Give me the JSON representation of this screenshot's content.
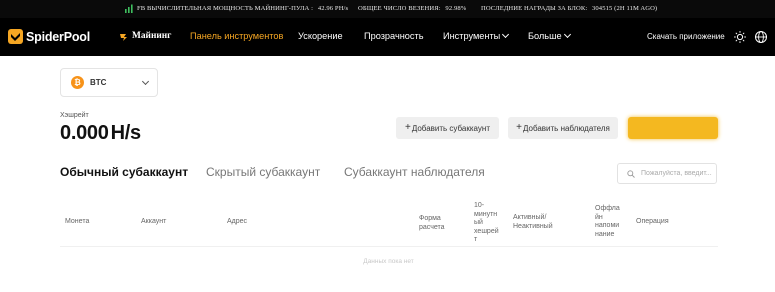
{
  "ticker": {
    "pool_power_label": "FB ВЫЧИСЛИТЕЛЬНАЯ МОЩНОСТЬ МАЙНИНГ-ПУЛА :",
    "pool_power_value": "42.96 PH/s",
    "luck_label": "ОБЩЕЕ ЧИСЛО ВЕЗЕНИЯ:",
    "luck_value": "92.98%",
    "last_block_label": "ПОСЛЕДНИЕ НАГРАДЫ ЗА БЛОК:",
    "last_block_value": "304515 (2H 11M AGO)"
  },
  "nav": {
    "brand": "SpiderPool",
    "mining": "Майнинг",
    "control_panel": "Панель инструментов",
    "acceleration": "Ускорение",
    "transparency": "Прозрачность",
    "tools": "Инструменты",
    "more": "Больше",
    "download": "Скачать приложение"
  },
  "coin_select": {
    "value": "BTC",
    "icon_letter": "₿"
  },
  "hashrate": {
    "label": "Хэшрейт",
    "value": "0.000",
    "unit": "H/s"
  },
  "buttons": {
    "add_subaccount": "Добавить субаккаунт",
    "add_observer": "Добавить наблюдателя"
  },
  "tabs": {
    "normal": "Обычный субаккаунт",
    "hidden": "Скрытый субаккаунт",
    "observer": "Субаккаунт наблюдателя"
  },
  "search": {
    "placeholder": "Пожалуйста, введит..."
  },
  "table": {
    "columns": {
      "coin": "Монета",
      "account": "Аккаунт",
      "address": "Адрес",
      "payment_form_1": "Форма",
      "payment_form_2": "расчета",
      "ten_min_1": "10-",
      "ten_min_2": "минутн",
      "ten_min_3": "ый",
      "ten_min_4": "хешрей",
      "ten_min_5": "т",
      "active_1": "Активный/",
      "active_2": "Неактивный",
      "offline_1": "Оффла",
      "offline_2": "йн",
      "offline_3": "напоми",
      "offline_4": "нание",
      "operation": "Операция"
    },
    "empty": "Данных пока нет"
  },
  "colors": {
    "accent": "#f5a623",
    "btc": "#f7931a",
    "navbar": "#000000"
  }
}
